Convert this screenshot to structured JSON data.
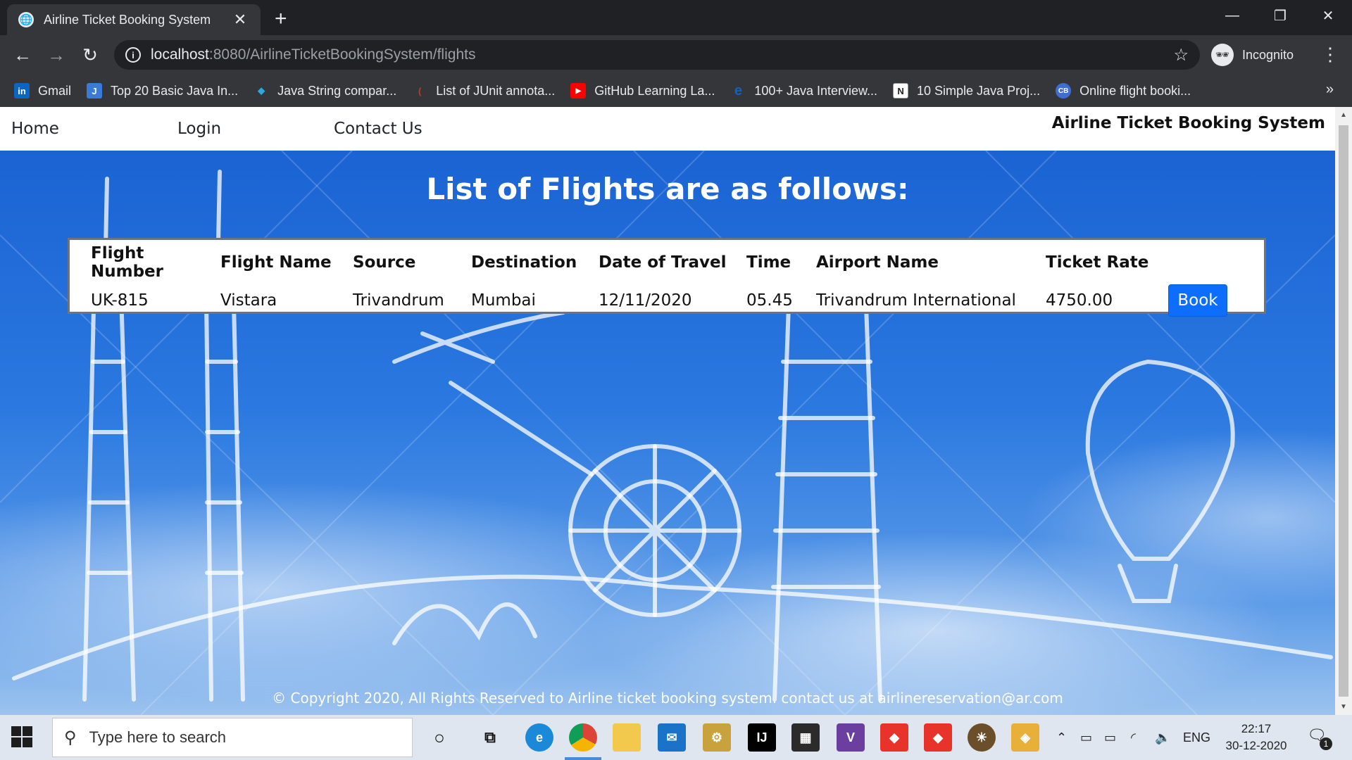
{
  "browser": {
    "tab_title": "Airline Ticket Booking System",
    "url_host": "localhost",
    "url_rest": ":8080/AirlineTicketBookingSystem/flights",
    "profile_label": "Incognito",
    "bookmarks": [
      {
        "label": "Gmail",
        "icon_text": "in",
        "icon_color": "#0a66c2"
      },
      {
        "label": "Top 20 Basic Java In...",
        "icon_text": "J",
        "icon_color": "#3b7bd8"
      },
      {
        "label": "Java String compar...",
        "icon_text": "◆",
        "icon_color": "#29a9e0"
      },
      {
        "label": "List of JUnit annota...",
        "icon_text": "(",
        "icon_color": "#c0392b"
      },
      {
        "label": "GitHub Learning La...",
        "icon_text": "▶",
        "icon_color": "#ff0000"
      },
      {
        "label": "100+ Java Interview...",
        "icon_text": "e",
        "icon_color": "#1a5fb4"
      },
      {
        "label": "10 Simple Java Proj...",
        "icon_text": "N",
        "icon_color": "#222222"
      },
      {
        "label": "Online flight booki...",
        "icon_text": "CB",
        "icon_color": "#3d6fd1"
      }
    ]
  },
  "site": {
    "nav": {
      "home": "Home",
      "login": "Login",
      "contact": "Contact Us"
    },
    "brand": "Airline Ticket Booking System",
    "heading": "List of Flights are as follows:",
    "table": {
      "headers": [
        "Flight Number",
        "Flight Name",
        "Source",
        "Destination",
        "Date of Travel",
        "Time",
        "Airport Name",
        "Ticket Rate"
      ],
      "rows": [
        {
          "flight_number": "UK-815",
          "flight_name": "Vistara",
          "source": "Trivandrum",
          "destination": "Mumbai",
          "date": "12/11/2020",
          "time": "05.45",
          "airport": "Trivandrum International",
          "rate": "4750.00",
          "action": "Book"
        }
      ]
    },
    "footer": "© Copyright 2020, All Rights Reserved to Airline ticket booking system. contact us at airlinereservation@ar.com"
  },
  "taskbar": {
    "search_placeholder": "Type here to search",
    "lang": "ENG",
    "time": "22:17",
    "date": "30-12-2020",
    "notification_count": "1"
  },
  "colors": {
    "accent": "#0d6efd",
    "sky": "#2a78e0"
  }
}
